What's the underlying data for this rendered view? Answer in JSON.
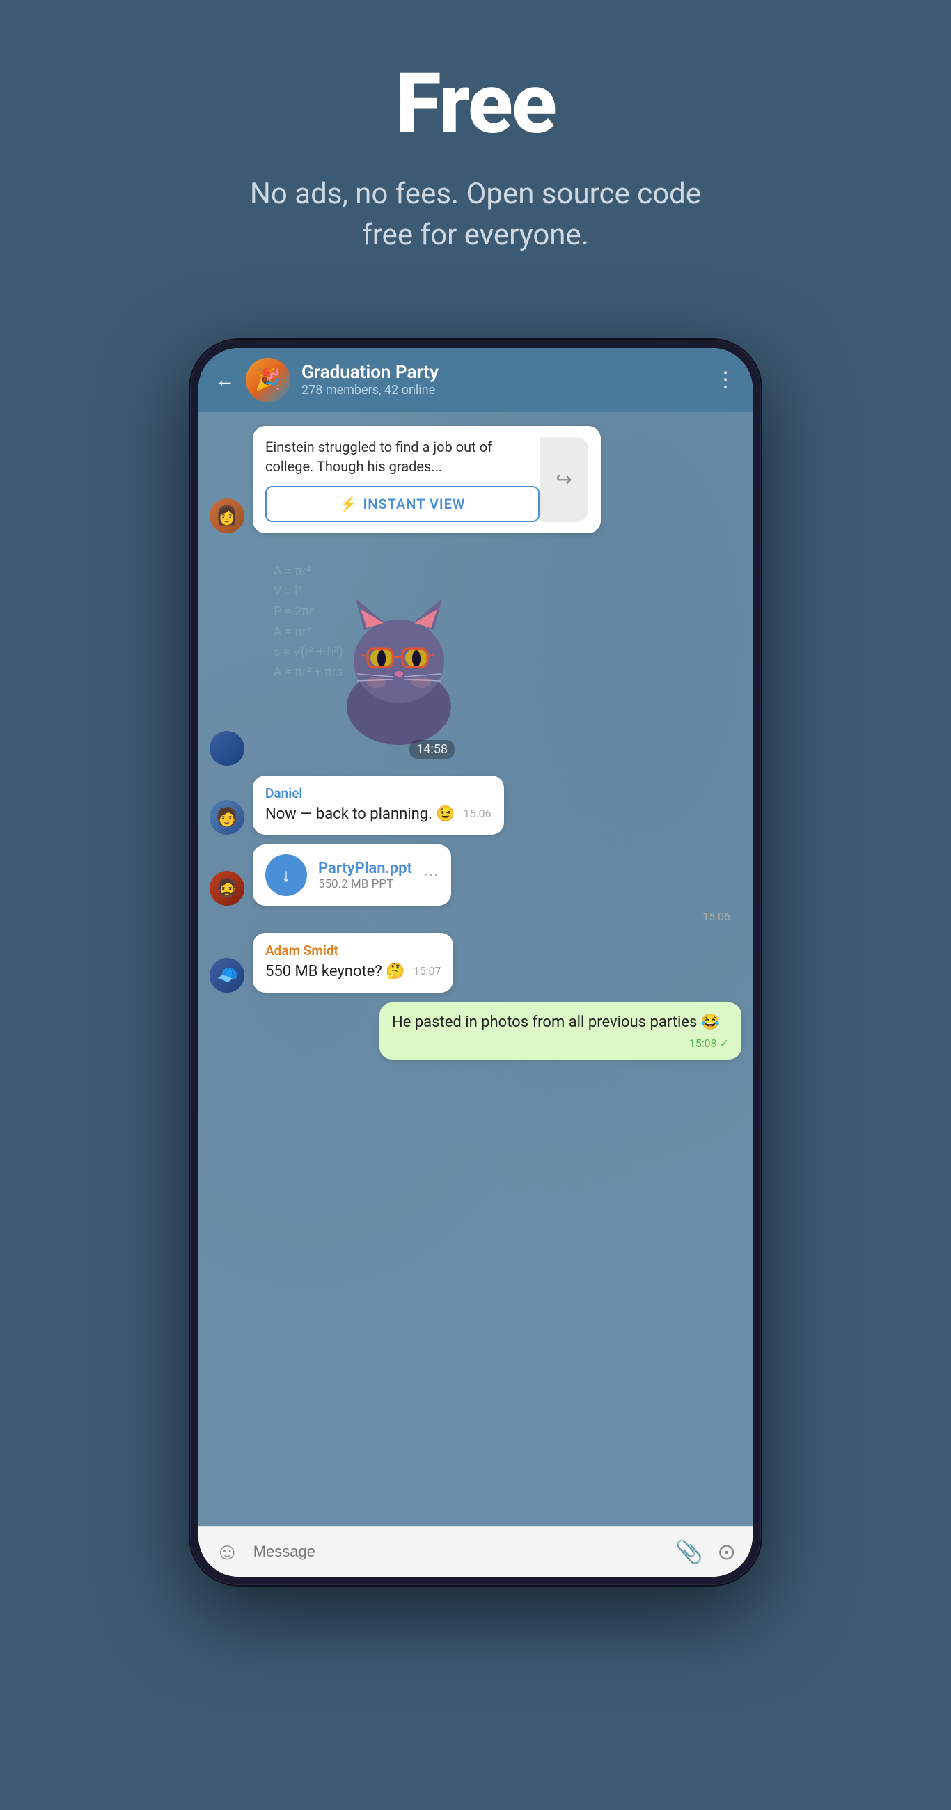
{
  "hero": {
    "title": "Free",
    "subtitle": "No ads, no fees. Open source code free for everyone."
  },
  "header": {
    "back_label": "←",
    "chat_name": "Graduation Party",
    "chat_members": "278 members, 42 online",
    "menu_icon": "⋮"
  },
  "messages": [
    {
      "id": "link-preview",
      "type": "link",
      "text": "Einstein struggled to find a job out of college. Though his grades...",
      "instant_view_label": "INSTANT VIEW"
    },
    {
      "id": "sticker",
      "type": "sticker",
      "time": "14:58"
    },
    {
      "id": "daniel-msg",
      "type": "text",
      "sender": "Daniel",
      "text": "Now — back to planning. 😉",
      "time": "15:06"
    },
    {
      "id": "file-msg",
      "type": "file",
      "filename": "PartyPlan.ppt",
      "filesize": "550.2 MB PPT",
      "time": "15:06"
    },
    {
      "id": "adam-msg",
      "type": "text",
      "sender": "Adam Smidt",
      "text": "550 MB keynote? 🤔",
      "time": "15:07"
    },
    {
      "id": "own-msg",
      "type": "own",
      "text": "He pasted in photos from all previous parties 😂",
      "time": "15:08",
      "check": "✓"
    }
  ],
  "input_bar": {
    "placeholder": "Message",
    "emoji_icon": "☺",
    "attach_icon": "📎",
    "camera_icon": "⊙"
  }
}
